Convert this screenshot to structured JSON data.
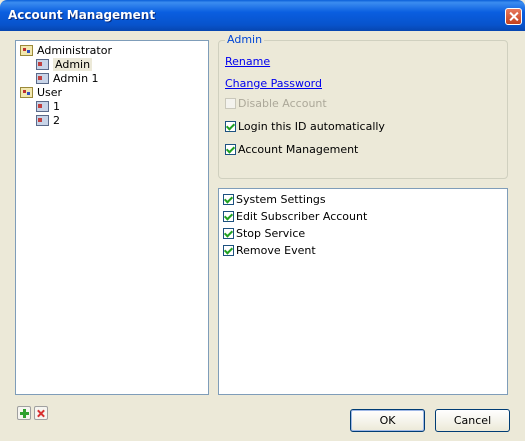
{
  "window": {
    "title": "Account Management"
  },
  "tree": {
    "groups": [
      {
        "label": "Administrator",
        "users": [
          "Admin",
          "Admin 1"
        ]
      },
      {
        "label": "User",
        "users": [
          "1",
          "2"
        ]
      }
    ],
    "selected": "Admin"
  },
  "details": {
    "legend": "Admin",
    "rename": "Rename",
    "change_password": "Change Password",
    "disable_account": {
      "label": "Disable Account",
      "checked": false,
      "enabled": false
    },
    "login_auto": {
      "label": "Login this ID automatically",
      "checked": true
    },
    "account_mgmt": {
      "label": "Account Management",
      "checked": true
    }
  },
  "permissions": [
    {
      "label": "System Settings",
      "checked": true
    },
    {
      "label": "Edit Subscriber Account",
      "checked": true
    },
    {
      "label": "Stop Service",
      "checked": true
    },
    {
      "label": "Remove Event",
      "checked": true
    }
  ],
  "buttons": {
    "ok": "OK",
    "cancel": "Cancel"
  },
  "icons": {
    "add": "add-icon",
    "delete": "delete-icon",
    "close": "close-icon"
  }
}
